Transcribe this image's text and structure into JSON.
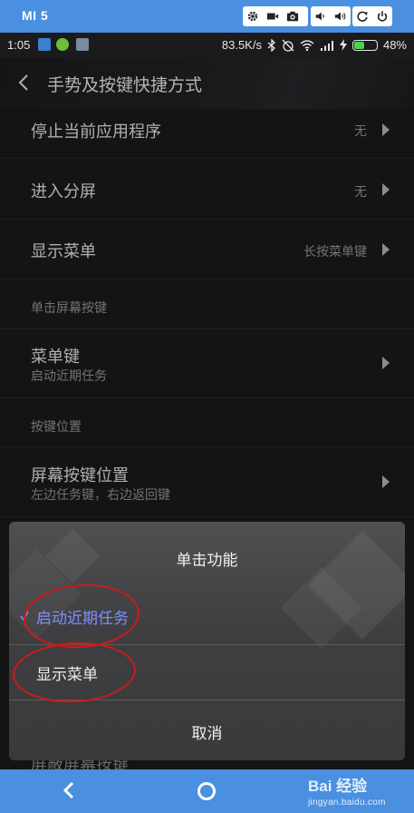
{
  "emulator": {
    "device_name": "MI 5",
    "tools": [
      "settings-icon",
      "video-icon",
      "camera-icon",
      "volume-down-icon",
      "volume-up-icon",
      "rotate-icon",
      "power-icon"
    ]
  },
  "status_bar": {
    "time": "1:05",
    "network_speed": "83.5K/s",
    "battery_percent": "48%",
    "battery_level": 0.48,
    "battery_color": "#4fd34f"
  },
  "header": {
    "title": "手势及按键快捷方式"
  },
  "settings": {
    "rows": [
      {
        "title": "停止当前应用程序",
        "value": "无"
      },
      {
        "title": "进入分屏",
        "value": "无"
      },
      {
        "title": "显示菜单",
        "value": "长按菜单键"
      }
    ],
    "section1": "单击屏幕按键",
    "menu_key": {
      "title": "菜单键",
      "subtitle": "启动近期任务"
    },
    "section2": "按键位置",
    "key_position": {
      "title": "屏幕按键位置",
      "subtitle": "左边任务键，右边返回键"
    },
    "peek_row": "屏蔽屏幕按键"
  },
  "dialog": {
    "title": "单击功能",
    "options": [
      {
        "label": "启动近期任务",
        "selected": true
      },
      {
        "label": "显示菜单",
        "selected": false
      }
    ],
    "cancel": "取消",
    "selected_color": "#7f8fff"
  },
  "navigation": {
    "accent": "#4a8fe0"
  },
  "watermark": {
    "main": "Bai 经验",
    "sub": "jingyan.baidu.com"
  }
}
